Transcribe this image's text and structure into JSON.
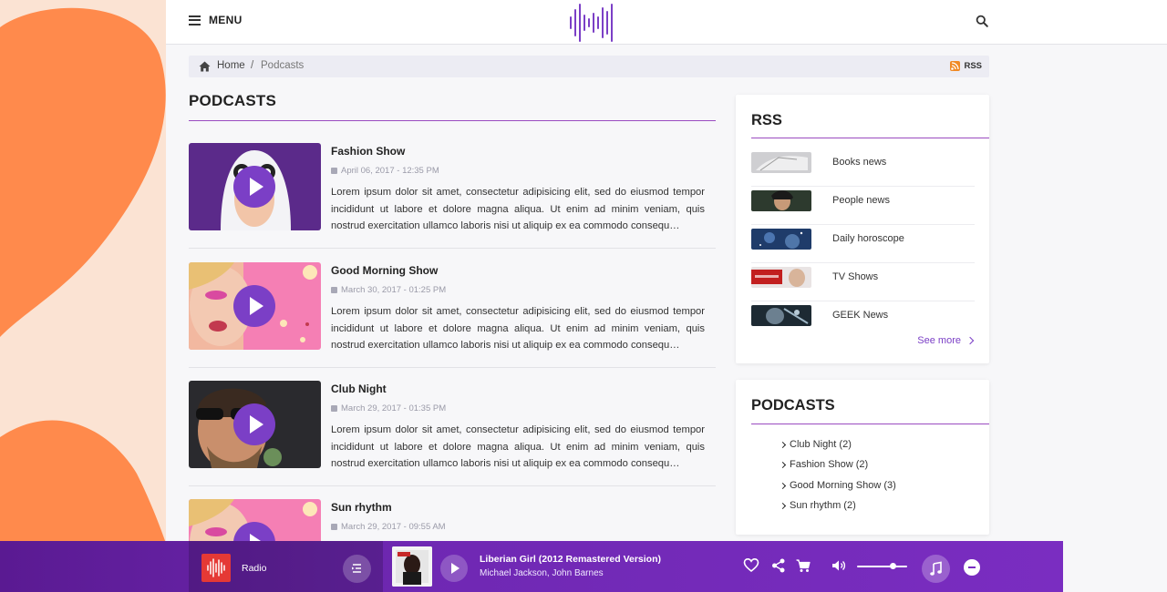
{
  "header": {
    "menu_label": "MENU",
    "logo_icon": "soundwave-logo-icon",
    "search_icon": "search-icon"
  },
  "breadcrumb": {
    "home": "Home",
    "separator": "/",
    "current": "Podcasts",
    "rss_label": "RSS"
  },
  "main": {
    "title": "PODCASTS",
    "items": [
      {
        "title": "Fashion Show",
        "date": "April 06, 2017 - 12:35 PM",
        "text": "Lorem ipsum dolor sit amet, consectetur adipisicing elit, sed do eiusmod tempor incididunt ut labore et dolore magna aliqua. Ut enim ad minim veniam, quis nostrud exercitation ullamco laboris nisi ut aliquip ex ea commodo consequ…"
      },
      {
        "title": "Good Morning Show",
        "date": "March 30, 2017 - 01:25 PM",
        "text": "Lorem ipsum dolor sit amet, consectetur adipisicing elit, sed do eiusmod tempor incididunt ut labore et dolore magna aliqua. Ut enim ad minim veniam, quis nostrud exercitation ullamco laboris nisi ut aliquip ex ea commodo consequ…"
      },
      {
        "title": "Club Night",
        "date": "March 29, 2017 - 01:35 PM",
        "text": "Lorem ipsum dolor sit amet, consectetur adipisicing elit, sed do eiusmod tempor incididunt ut labore et dolore magna aliqua. Ut enim ad minim veniam, quis nostrud exercitation ullamco laboris nisi ut aliquip ex ea commodo consequ…"
      },
      {
        "title": "Sun rhythm",
        "date": "March 29, 2017 - 09:55 AM",
        "text": ""
      }
    ]
  },
  "sidebar": {
    "rss": {
      "title": "RSS",
      "items": [
        {
          "label": "Books news"
        },
        {
          "label": "People news"
        },
        {
          "label": "Daily horoscope"
        },
        {
          "label": "TV Shows"
        },
        {
          "label": "GEEK News"
        }
      ],
      "see_more": "See more"
    },
    "podcasts": {
      "title": "PODCASTS",
      "categories": [
        {
          "label": "Club Night (2)"
        },
        {
          "label": "Fashion Show (2)"
        },
        {
          "label": "Good Morning Show (3)"
        },
        {
          "label": "Sun rhythm (2)"
        }
      ]
    }
  },
  "player": {
    "source_label": "Radio",
    "track_title": "Liberian Girl (2012 Remastered Version)",
    "track_artist": "Michael Jackson, John Barnes",
    "volume": 0.7
  },
  "colors": {
    "accent": "#7b3fc6",
    "player_bg": "#6f28b3",
    "decor_orange": "#ff8a4c",
    "decor_peach": "#fbe3d3"
  }
}
